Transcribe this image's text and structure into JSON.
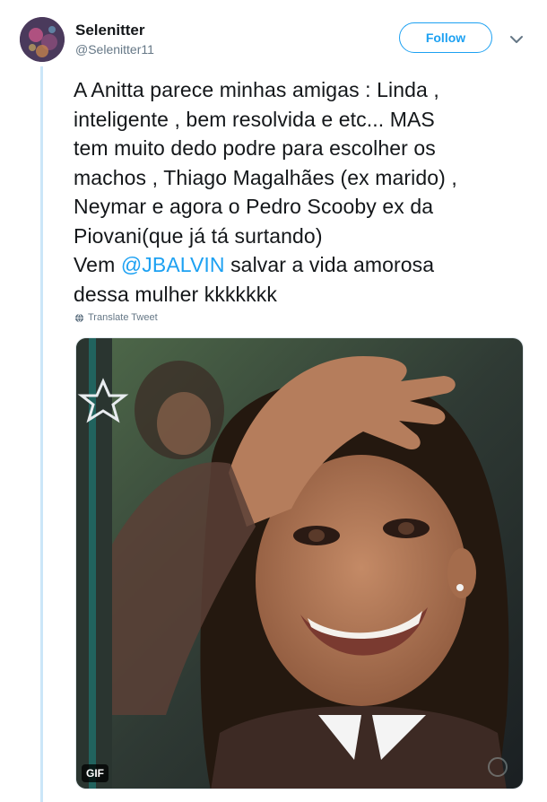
{
  "author": {
    "display_name": "Selenitter",
    "handle": "@Selenitter11"
  },
  "follow_button": {
    "label": "Follow"
  },
  "tweet": {
    "lines": [
      {
        "text": "A Anitta parece minhas amigas : Linda ,"
      },
      {
        "text": "inteligente , bem resolvida e etc... MAS"
      },
      {
        "text": "tem muito dedo podre para escolher os"
      },
      {
        "text": "machos , Thiago Magalhães (ex marido) ,"
      },
      {
        "text": "Neymar e agora o Pedro Scooby ex da"
      },
      {
        "text": "Piovani(que já tá surtando)"
      }
    ],
    "mention_line": {
      "prefix": "Vem ",
      "mention": "@JBALVIN",
      "suffix": " salvar a vida amorosa"
    },
    "last_line": "dessa mulher kkkkkkk"
  },
  "translate": {
    "label": "Translate Tweet",
    "icon": "globe-icon"
  },
  "media": {
    "type": "gif",
    "badge": "GIF",
    "colors": {
      "background": "#3b4a3c",
      "skin": "#b07a58",
      "hair": "#231812"
    }
  },
  "colors": {
    "accent": "#1da1f2",
    "text": "#14171a",
    "secondary_text": "#657786",
    "thread_line": "#cbe6f8"
  }
}
